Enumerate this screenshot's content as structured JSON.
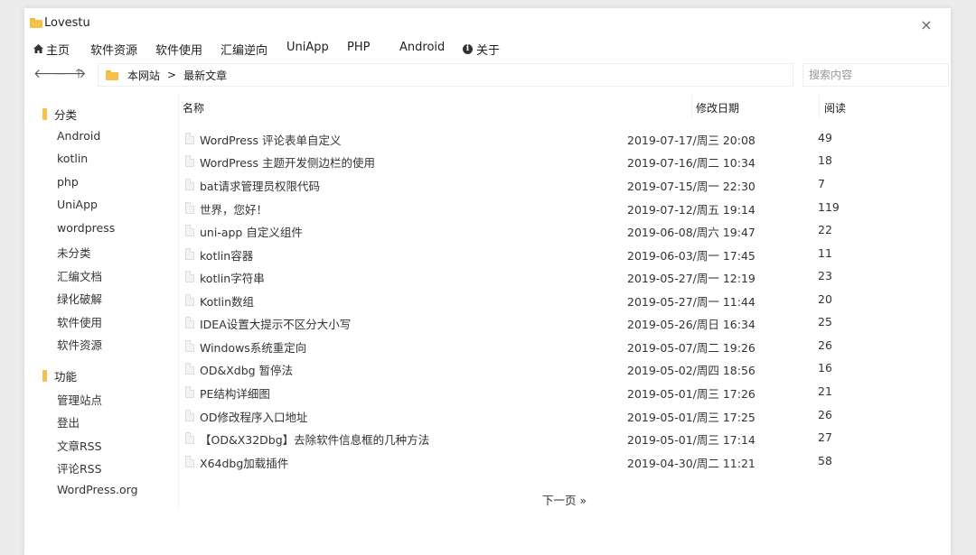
{
  "window": {
    "title": "Lovestu",
    "close_glyph": "×"
  },
  "menu": [
    {
      "label": "主页",
      "icon": "home-icon"
    },
    {
      "label": "软件资源"
    },
    {
      "label": "软件使用"
    },
    {
      "label": "汇编逆向"
    },
    {
      "label": "UniApp"
    },
    {
      "label": "PHP"
    },
    {
      "label": "Android"
    },
    {
      "label": "关于",
      "icon": "info-icon"
    }
  ],
  "toolbar": {
    "back_glyph": "🡐",
    "forward_glyph": "🡒",
    "up_glyph": "🡑",
    "breadcrumb": [
      "本网站",
      "最新文章"
    ],
    "separator": ">",
    "search_placeholder": "搜索内容"
  },
  "sidebar": {
    "groups": [
      {
        "label": "分类",
        "items": [
          "Android",
          "kotlin",
          "php",
          "UniApp",
          "wordpress",
          "未分类",
          "汇编文档",
          "绿化破解",
          "软件使用",
          "软件资源"
        ]
      },
      {
        "label": "功能",
        "items": [
          "管理站点",
          "登出",
          "文章RSS",
          "评论RSS",
          "WordPress.org"
        ]
      }
    ]
  },
  "list": {
    "headers": {
      "name": "名称",
      "date": "修改日期",
      "views": "阅读"
    },
    "rows": [
      {
        "name": "WordPress 评论表单自定义",
        "date": "2019-07-17/周三 20:08",
        "views": "49"
      },
      {
        "name": "WordPress 主题开发侧边栏的使用",
        "date": "2019-07-16/周二 10:34",
        "views": "18"
      },
      {
        "name": "bat请求管理员权限代码",
        "date": "2019-07-15/周一 22:30",
        "views": "7"
      },
      {
        "name": "世界，您好！",
        "date": "2019-07-12/周五 19:14",
        "views": "119"
      },
      {
        "name": "uni-app 自定义组件",
        "date": "2019-06-08/周六 19:47",
        "views": "22"
      },
      {
        "name": "kotlin容器",
        "date": "2019-06-03/周一 17:45",
        "views": "11"
      },
      {
        "name": "kotlin字符串",
        "date": "2019-05-27/周一 12:19",
        "views": "23"
      },
      {
        "name": "Kotlin数组",
        "date": "2019-05-27/周一 11:44",
        "views": "20"
      },
      {
        "name": "IDEA设置大提示不区分大小写",
        "date": "2019-05-26/周日 16:34",
        "views": "25"
      },
      {
        "name": "Windows系统重定向",
        "date": "2019-05-07/周二 19:26",
        "views": "26"
      },
      {
        "name": "OD&Xdbg 暂停法",
        "date": "2019-05-02/周四 18:56",
        "views": "16"
      },
      {
        "name": "PE结构详细图",
        "date": "2019-05-01/周三 17:26",
        "views": "21"
      },
      {
        "name": "OD修改程序入口地址",
        "date": "2019-05-01/周三 17:25",
        "views": "26"
      },
      {
        "name": "【OD&X32Dbg】去除软件信息框的几种方法",
        "date": "2019-05-01/周三 17:14",
        "views": "27"
      },
      {
        "name": "X64dbg加载插件",
        "date": "2019-04-30/周二 11:21",
        "views": "58"
      }
    ]
  },
  "pager": {
    "next_label": "下一页 »"
  }
}
